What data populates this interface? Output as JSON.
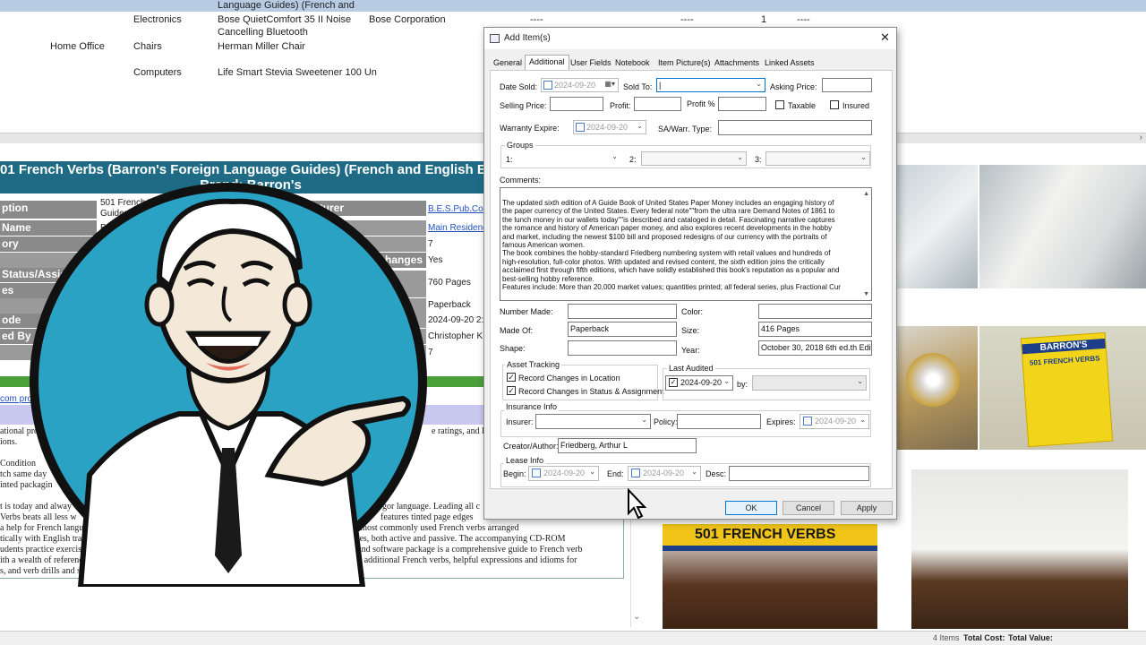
{
  "grid": {
    "top_partial": "Language Guides) (French and",
    "rows": [
      {
        "cat": "",
        "sub": "Electronics",
        "name": "Bose QuietComfort 35 II Noise",
        "name2": "Cancelling Bluetooth",
        "mfr": "Bose Corporation",
        "c1": "----",
        "c2": "----",
        "qty": "1",
        "c3": "----"
      },
      {
        "cat": "Home Office",
        "sub": "Chairs",
        "name": "Herman Miller Chair",
        "name2": "",
        "mfr": "",
        "c1": "",
        "c2": "",
        "qty": "",
        "c3": ""
      },
      {
        "cat": "",
        "sub": "Computers",
        "name": "Life Smart Stevia Sweetener 100 Un",
        "name2": "",
        "mfr": "",
        "c1": "",
        "c2": "",
        "qty": "",
        "c3": ""
      }
    ]
  },
  "report": {
    "title_line1": "01 French Verbs (Barron's Foreign Language Guides) (French and English Editi",
    "title_line2": "Brand: Barron's",
    "labels": [
      "ption",
      "Name",
      "ory",
      "Status/Assign",
      "es",
      "ode",
      "ed By"
    ],
    "desc_value": "501 French Ve",
    "desc_value2": "Guides) (",
    "name_value": "Br",
    "mfr_label": "ufacturer",
    "changes_label": "hanges",
    "right_values": [
      "B.E.S.Pub.Co",
      "Main Residenc",
      "7",
      "Yes",
      "760 Pages",
      "Paperback",
      "2024-09-20 2:2",
      "Christopher K",
      "7"
    ],
    "link": "com pro",
    "text_lines": [
      "ational pro",
      "ions.",
      "Condition",
      "tch same day",
      "inted packagin",
      "t is today and alway",
      "Verbs beats all less w",
      "a help for French langu",
      "tically with English translat",
      "udents practice exercises in ve",
      "ith a wealth of reference material a",
      "s, and verb drills and short tests with all qu"
    ],
    "right_text_lines": [
      "e ratings, and lan",
      "gor language. Leading all c",
      "features tinted page edges",
      "ertant and most commonly used French verbs arranged",
      "s and tenses, both active and passive. The accompanying CD-ROM",
      "ted book and software package is a comprehensive guide to French verb",
      "than 1,250 additional French verbs, helpful expressions and idioms for"
    ],
    "book_spine": "501 FRENCH VERBS",
    "book_cover": "BARRON'S",
    "book_cover_sub": "501 FRENCH VERBS"
  },
  "status_bar": {
    "items": "4 Items",
    "total_cost": "Total Cost:",
    "total_value": "Total Value:"
  },
  "dialog": {
    "title": "Add Item(s)",
    "tabs": [
      "General",
      "Additional",
      "User Fields",
      "Notebook",
      "Item Picture(s)",
      "Attachments",
      "Linked Assets"
    ],
    "date_sold_label": "Date Sold:",
    "date_sold": "2024-09-20",
    "sold_to_label": "Sold To:",
    "sold_to": "|",
    "asking_price_label": "Asking Price:",
    "selling_price_label": "Selling Price:",
    "profit_label": "Profit:",
    "profit_pct_label": "Profit %",
    "taxable_label": "Taxable",
    "insured_label": "Insured",
    "warranty_label": "Warranty Expire:",
    "warranty_date": "2024-09-20",
    "sawarr_label": "SA/Warr. Type:",
    "groups_label": "Groups",
    "group_labels": [
      "1:",
      "2:",
      "3:"
    ],
    "comments_label": "Comments:",
    "comments": [
      "The updated sixth edition of A Guide Book of United States Paper Money includes an engaging history of",
      "the paper currency of the United States. Every federal note\"\"from the ultra rare Demand Notes of 1861 to",
      "the lunch money in our wallets today\"\"is described and cataloged in detail. Fascinating narrative captures",
      "the romance and history of American paper money, and also explores recent developments in the hobby",
      "and market, including the newest $100 bill and proposed redesigns of our currency with the portraits of",
      "famous American women.",
      "The book combines the hobby-standard Friedberg numbering system with retail values and hundreds of",
      "high-resolution, full-color photos. With updated and revised content, the sixth edition joins the critically",
      "acclaimed first through fifth editions, which have solidly established this book's reputation as a popular and",
      "best-selling hobby reference.",
      "Features include: More than 20,000 market values; quantities printed; all federal series, plus Fractional Cur"
    ],
    "number_made_label": "Number Made:",
    "color_label": "Color:",
    "made_of_label": "Made Of:",
    "made_of": "Paperback",
    "size_label": "Size:",
    "size": "416 Pages",
    "shape_label": "Shape:",
    "year_label": "Year:",
    "year": "October 30, 2018 6th ed.th Editi",
    "asset_tracking_label": "Asset Tracking",
    "record_location": "Record Changes in Location",
    "record_status": "Record Changes in Status & Assignment",
    "last_audited_label": "Last Audited",
    "last_audited": "2024-09-20",
    "by_label": "by:",
    "insurance_label": "Insurance Info",
    "insurer_label": "Insurer:",
    "policy_label": "Policy:",
    "expires_label": "Expires:",
    "expires_date": "2024-09-20",
    "creator_label": "Creator/Author:",
    "creator": "Friedberg, Arthur L",
    "lease_label": "Lease Info",
    "begin_label": "Begin:",
    "begin_date": "2024-09-20",
    "end_label": "End:",
    "end_date": "2024-09-20",
    "desc_label": "Desc:",
    "ok": "OK",
    "cancel": "Cancel",
    "apply": "Apply",
    "close_glyph": "✕"
  }
}
